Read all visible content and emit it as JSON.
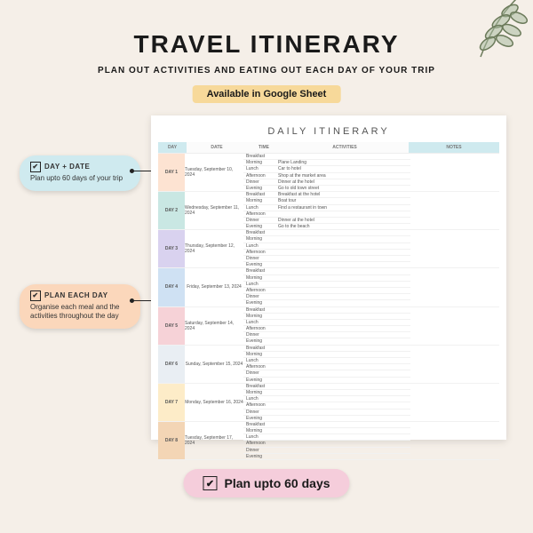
{
  "header": {
    "title": "TRAVEL ITINERARY",
    "subtitle": "PLAN OUT ACTIVITIES AND EATING OUT EACH DAY OF YOUR TRIP",
    "badge": "Available in Google Sheet"
  },
  "callouts": [
    {
      "heading": "DAY + DATE",
      "text": "Plan upto 60 days of your trip"
    },
    {
      "heading": "PLAN EACH DAY",
      "text": "Organise each meal and the activities throughout the day"
    }
  ],
  "sheet": {
    "title": "DAILY ITINERARY",
    "columns": [
      "DAY",
      "DATE",
      "TIME",
      "ACTIVITIES",
      "NOTES"
    ],
    "time_slots": [
      "Breakfast",
      "Morning",
      "Lunch",
      "Afternoon",
      "Dinner",
      "Evening"
    ],
    "days": [
      {
        "label": "DAY 1",
        "date": "Tuesday, September 10, 2024",
        "color": "#fde3d2",
        "activities": [
          "",
          "Plane Landing",
          "Car to hotel",
          "Shop at the market area",
          "Dinner at the hotel",
          "Go to old town street"
        ]
      },
      {
        "label": "DAY 2",
        "date": "Wednesday, September 11, 2024",
        "color": "#c9e7e3",
        "activities": [
          "Breakfast at the hotel",
          "Boat tour",
          "Find a restaurant in town",
          "",
          "Dinner at the hotel",
          "Go to the beach"
        ]
      },
      {
        "label": "DAY 3",
        "date": "Thursday, September 12, 2024",
        "color": "#d9d2ef",
        "activities": [
          "",
          "",
          "",
          "",
          "",
          ""
        ]
      },
      {
        "label": "DAY 4",
        "date": "Friday, September 13, 2024",
        "color": "#cfe1f3",
        "activities": [
          "",
          "",
          "",
          "",
          "",
          ""
        ]
      },
      {
        "label": "DAY 5",
        "date": "Saturday, September 14, 2024",
        "color": "#f6d2d7",
        "activities": [
          "",
          "",
          "",
          "",
          "",
          ""
        ]
      },
      {
        "label": "DAY 6",
        "date": "Sunday, September 15, 2024",
        "color": "#e9eef3",
        "activities": [
          "",
          "",
          "",
          "",
          "",
          ""
        ]
      },
      {
        "label": "DAY 7",
        "date": "Monday, September 16, 2024",
        "color": "#fdecc8",
        "activities": [
          "",
          "",
          "",
          "",
          "",
          ""
        ]
      },
      {
        "label": "DAY 8",
        "date": "Tuesday, September 17, 2024",
        "color": "#f3d5b5",
        "activities": [
          "",
          "",
          "",
          "",
          "",
          ""
        ]
      }
    ]
  },
  "footer": {
    "pill": "Plan upto 60 days"
  }
}
